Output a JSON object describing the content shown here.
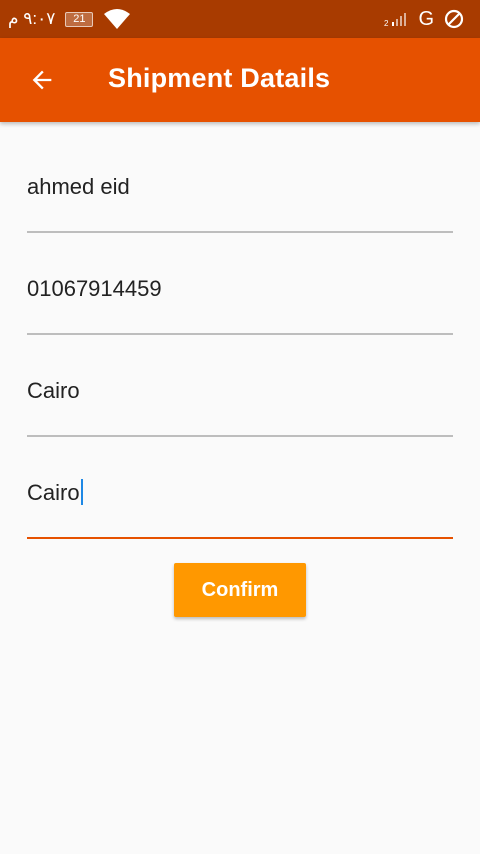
{
  "status_bar": {
    "time": "٩:٠٧ م",
    "battery_level": "21",
    "network_type": "G",
    "icons": [
      "battery-icon",
      "wifi-icon",
      "signal-icon",
      "dnd-icon"
    ],
    "background_color": "#a83b00"
  },
  "app_bar": {
    "title": "Shipment Datails",
    "back_icon": "arrow-left-icon",
    "background_color": "#e65100"
  },
  "form": {
    "fields": [
      {
        "value": "ahmed eid",
        "focused": false
      },
      {
        "value": "01067914459",
        "focused": false
      },
      {
        "value": "Cairo",
        "focused": false
      },
      {
        "value": "Cairo",
        "focused": true
      }
    ]
  },
  "confirm_button": {
    "label": "Confirm",
    "color": "#ff9800"
  }
}
